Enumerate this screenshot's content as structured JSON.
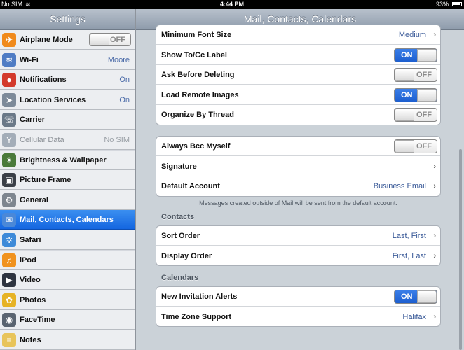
{
  "status_bar": {
    "carrier": "No SIM",
    "time": "4:44 PM",
    "battery": "93%"
  },
  "sidebar": {
    "title": "Settings",
    "items": [
      {
        "name": "airplane",
        "label": "Airplane Mode",
        "toggle": "OFF",
        "icon": "airplane-icon",
        "color": "#f08a1c",
        "glyph": "✈"
      },
      {
        "name": "wifi",
        "label": "Wi-Fi",
        "value": "Moore",
        "icon": "wifi-icon",
        "color": "#4f7cc4",
        "glyph": "≋"
      },
      {
        "name": "notifications",
        "label": "Notifications",
        "value": "On",
        "icon": "notifications-icon",
        "color": "#d33a2c",
        "glyph": "●"
      },
      {
        "name": "location",
        "label": "Location Services",
        "value": "On",
        "icon": "location-arrow-icon",
        "color": "#7d8a99",
        "glyph": "➤"
      },
      {
        "name": "carrier",
        "label": "Carrier",
        "icon": "phone-icon",
        "color": "#6b7988",
        "glyph": "☏"
      },
      {
        "name": "cellular",
        "label": "Cellular Data",
        "value": "No SIM",
        "icon": "cellular-antenna-icon",
        "color": "#a3adb8",
        "glyph": "Y",
        "disabled": true
      },
      {
        "name": "brightness",
        "label": "Brightness & Wallpaper",
        "icon": "brightness-icon",
        "color": "#4a7a3a",
        "glyph": "☀"
      },
      {
        "name": "picture-frame",
        "label": "Picture Frame",
        "icon": "picture-frame-icon",
        "color": "#3a3f47",
        "glyph": "▣"
      },
      {
        "name": "general",
        "label": "General",
        "icon": "gear-icon",
        "color": "#7e868f",
        "glyph": "⚙"
      },
      {
        "name": "mail",
        "label": "Mail, Contacts, Calendars",
        "icon": "mail-icon",
        "color": "#4a88d8",
        "glyph": "✉",
        "selected": true
      },
      {
        "name": "safari",
        "label": "Safari",
        "icon": "safari-compass-icon",
        "color": "#3e8ad8",
        "glyph": "✲"
      },
      {
        "name": "ipod",
        "label": "iPod",
        "icon": "ipod-icon",
        "color": "#f0921e",
        "glyph": "♫"
      },
      {
        "name": "video",
        "label": "Video",
        "icon": "video-icon",
        "color": "#2e3440",
        "glyph": "▶"
      },
      {
        "name": "photos",
        "label": "Photos",
        "icon": "photos-sunflower-icon",
        "color": "#e6b325",
        "glyph": "✿"
      },
      {
        "name": "facetime",
        "label": "FaceTime",
        "icon": "facetime-camera-icon",
        "color": "#5a6470",
        "glyph": "◉"
      },
      {
        "name": "notes",
        "label": "Notes",
        "icon": "notes-icon",
        "color": "#e8c45a",
        "glyph": "≡"
      }
    ]
  },
  "main": {
    "title": "Mail, Contacts, Calendars",
    "mail_group_1": [
      {
        "name": "minimum-font-size",
        "label": "Minimum Font Size",
        "value": "Medium",
        "chevron": true
      },
      {
        "name": "show-to-cc-label",
        "label": "Show To/Cc Label",
        "toggle": "ON"
      },
      {
        "name": "ask-before-deleting",
        "label": "Ask Before Deleting",
        "toggle": "OFF"
      },
      {
        "name": "load-remote-images",
        "label": "Load Remote Images",
        "toggle": "ON"
      },
      {
        "name": "organize-by-thread",
        "label": "Organize By Thread",
        "toggle": "OFF"
      }
    ],
    "mail_group_2": [
      {
        "name": "always-bcc-myself",
        "label": "Always Bcc Myself",
        "toggle": "OFF"
      },
      {
        "name": "signature",
        "label": "Signature",
        "chevron": true
      },
      {
        "name": "default-account",
        "label": "Default Account",
        "value": "Business Email",
        "chevron": true
      }
    ],
    "default_account_note": "Messages created outside of Mail will be sent from the default account.",
    "contacts_header": "Contacts",
    "contacts_group": [
      {
        "name": "sort-order",
        "label": "Sort Order",
        "value": "Last, First",
        "chevron": true
      },
      {
        "name": "display-order",
        "label": "Display Order",
        "value": "First, Last",
        "chevron": true
      }
    ],
    "calendars_header": "Calendars",
    "calendars_group": [
      {
        "name": "new-invitation-alerts",
        "label": "New Invitation Alerts",
        "toggle": "ON"
      },
      {
        "name": "time-zone-support",
        "label": "Time Zone Support",
        "value": "Halifax",
        "chevron": true
      }
    ]
  }
}
